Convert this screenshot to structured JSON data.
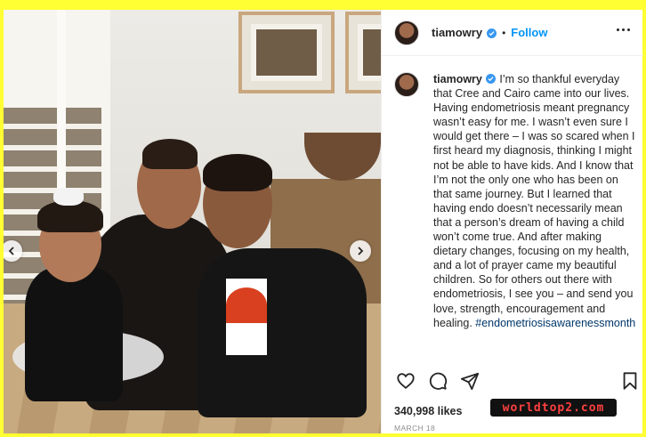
{
  "post": {
    "username": "tiamowry",
    "follow_label": "Follow",
    "separator": "•",
    "caption": {
      "username": "tiamowry",
      "text": " I’m so thankful everyday that Cree and Cairo came into our lives. Having endometriosis meant pregnancy wasn’t easy for me. I wasn’t even sure I would get there – I was so scared when I first heard my diagnosis, thinking I might not be able to have kids. And I know that I’m not the only one who has been on that same journey. But I learned that having endo doesn’t necessarily mean that a person’s dream of having a child won’t come true. And after making dietary changes, focusing on my health, and a lot of prayer came my beautiful children. So for others out there with endometriosis, I see you – and send you love, strength, encouragement and healing.",
      "hashtag": "#endometriosisawarenessmonth"
    },
    "likes": "340,998 likes",
    "date": "MARCH 18"
  },
  "watermark": "worldtop2.com",
  "icons": {
    "verified": "verified-badge-icon",
    "more": "more-options-icon",
    "like": "heart-icon",
    "comment": "comment-icon",
    "share": "paper-plane-icon",
    "save": "bookmark-icon",
    "prev": "chevron-left-icon",
    "next": "chevron-right-icon"
  },
  "colors": {
    "accent": "#0095f6",
    "verified": "#3897f0",
    "border": "#ffff33",
    "text": "#262626",
    "muted": "#8e8e8e"
  }
}
